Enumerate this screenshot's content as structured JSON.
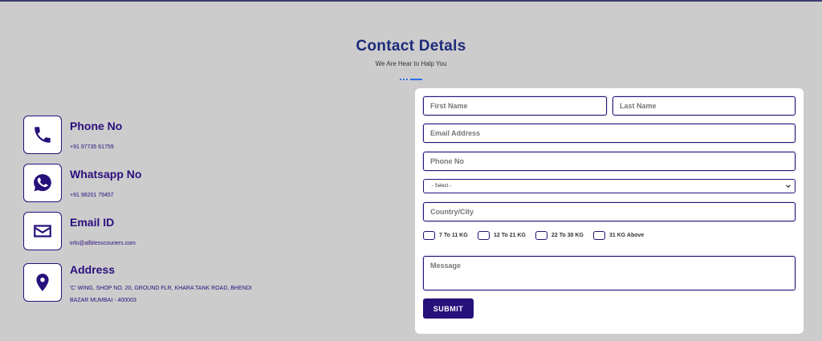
{
  "header": {
    "title": "Contact Detals",
    "subtitle": "We Are Hear to Halp You"
  },
  "contacts": [
    {
      "icon": "phone-icon",
      "title": "Phone No",
      "lines": [
        "+91 97735 61759"
      ]
    },
    {
      "icon": "whatsapp-icon",
      "title": "Whatsapp No",
      "lines": [
        "+91 98201 79457"
      ]
    },
    {
      "icon": "mail-icon",
      "title": "Email ID",
      "lines": [
        "info@allblesscouriers.com"
      ]
    },
    {
      "icon": "location-pin-icon",
      "title": "Address",
      "lines": [
        "'C' WING, SHOP NO. 20, GROUND FLR, KHARA TANK ROAD, BHENDI",
        "BAZAR MUMBAI - 400003"
      ]
    }
  ],
  "form": {
    "first_name_placeholder": "First Name",
    "last_name_placeholder": "Last Name",
    "email_placeholder": "Email Address",
    "phone_placeholder": "Phone No",
    "select_value": "- Select -",
    "country_placeholder": "Country/City",
    "weight_options": [
      "7 To 11 KG",
      "12 To 21 KG",
      "22 To 30 KG",
      "31 KG Above"
    ],
    "message_placeholder": "Message",
    "submit_label": "SUBMIT"
  },
  "colors": {
    "background": "#cccccc",
    "accent": "#26107a",
    "heading": "#1d2a7a",
    "underline": "#2e6fe6"
  }
}
